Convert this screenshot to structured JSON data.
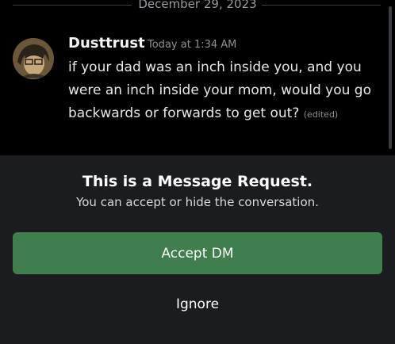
{
  "date_divider": "December 29, 2023",
  "message": {
    "username": "Dusttrust",
    "timestamp": "Today at 1:34 AM",
    "text": "if your dad was an inch inside you, and you were an inch inside your mom, would you go backwards or forwards to get out?",
    "edited_label": "(edited)"
  },
  "request": {
    "title": "This is a Message Request.",
    "subtitle": "You can accept or hide the conversation.",
    "accept_label": "Accept DM",
    "ignore_label": "Ignore"
  },
  "colors": {
    "background": "#000000",
    "panel": "#1b1c20",
    "accept_green": "#3e7f4d"
  }
}
